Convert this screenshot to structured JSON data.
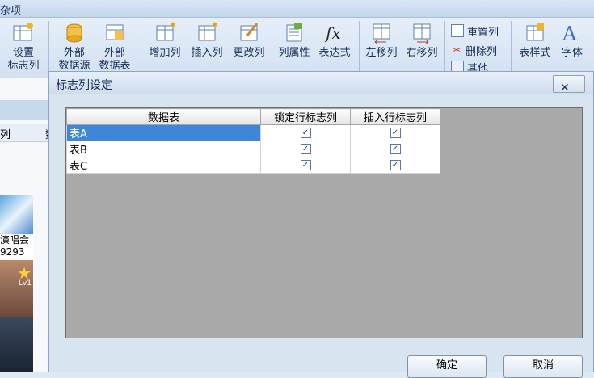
{
  "app": {
    "title_fragment": "杂项"
  },
  "ribbon": {
    "setup_col": "设置\n标志列",
    "ext_datasource": "外部\n数据源",
    "ext_datatable": "外部\n数据表",
    "add_col": "增加列",
    "insert_col": "插入列",
    "change_col": "更改列",
    "col_props": "列属性",
    "expression": "表达式",
    "move_left": "左移列",
    "move_right": "右移列",
    "reset_col": "重置列",
    "delete_col": "删除列",
    "other": "其他",
    "table_style": "表样式",
    "font": "字体"
  },
  "left_pane": {
    "header_1": "列",
    "header_2": "数",
    "ad_text_1": "演唱会",
    "ad_text_2": "9293",
    "badge": "Lv1"
  },
  "dialog": {
    "title": "标志列设定",
    "close": "✕",
    "columns": [
      "数据表",
      "锁定行标志列",
      "插入行标志列"
    ],
    "rows": [
      {
        "name": "表A",
        "lock": true,
        "insert": true,
        "selected": true
      },
      {
        "name": "表B",
        "lock": true,
        "insert": true,
        "selected": false
      },
      {
        "name": "表C",
        "lock": true,
        "insert": true,
        "selected": false
      }
    ],
    "ok": "确定",
    "cancel": "取消"
  },
  "colors": {
    "selection": "#3d86d8",
    "grid_bg": "#a9a9a9",
    "ribbon_text": "#15305a"
  }
}
